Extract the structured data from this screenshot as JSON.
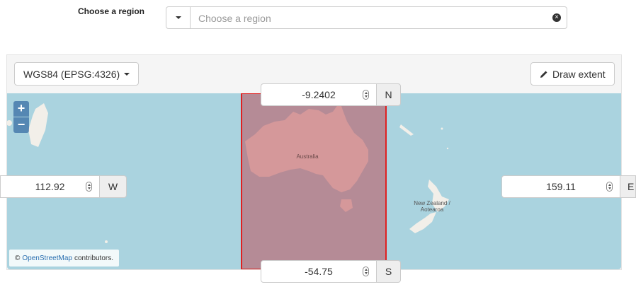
{
  "region": {
    "label": "Choose a region",
    "placeholder": "Choose a region"
  },
  "toolbar": {
    "crs_label": "WGS84 (EPSG:4326)",
    "draw_label": "Draw extent"
  },
  "map": {
    "zoom_in": "+",
    "zoom_out": "−",
    "labels": {
      "australia": "Australia",
      "new_zealand_1": "New Zealand /",
      "new_zealand_2": "Aotearoa"
    },
    "attribution": {
      "prefix": "©",
      "link": "OpenStreetMap",
      "suffix": "contributors."
    },
    "colors": {
      "water": "#aad3df",
      "land": "#f2efe9",
      "selection_fill": "rgba(220,80,80,0.35)",
      "selection_stroke": "#e02020"
    }
  },
  "extent": {
    "north": {
      "value": "-9.2402",
      "label": "N"
    },
    "south": {
      "value": "-54.75",
      "label": "S"
    },
    "west": {
      "value": "112.92",
      "label": "W"
    },
    "east": {
      "value": "159.11",
      "label": "E"
    }
  }
}
